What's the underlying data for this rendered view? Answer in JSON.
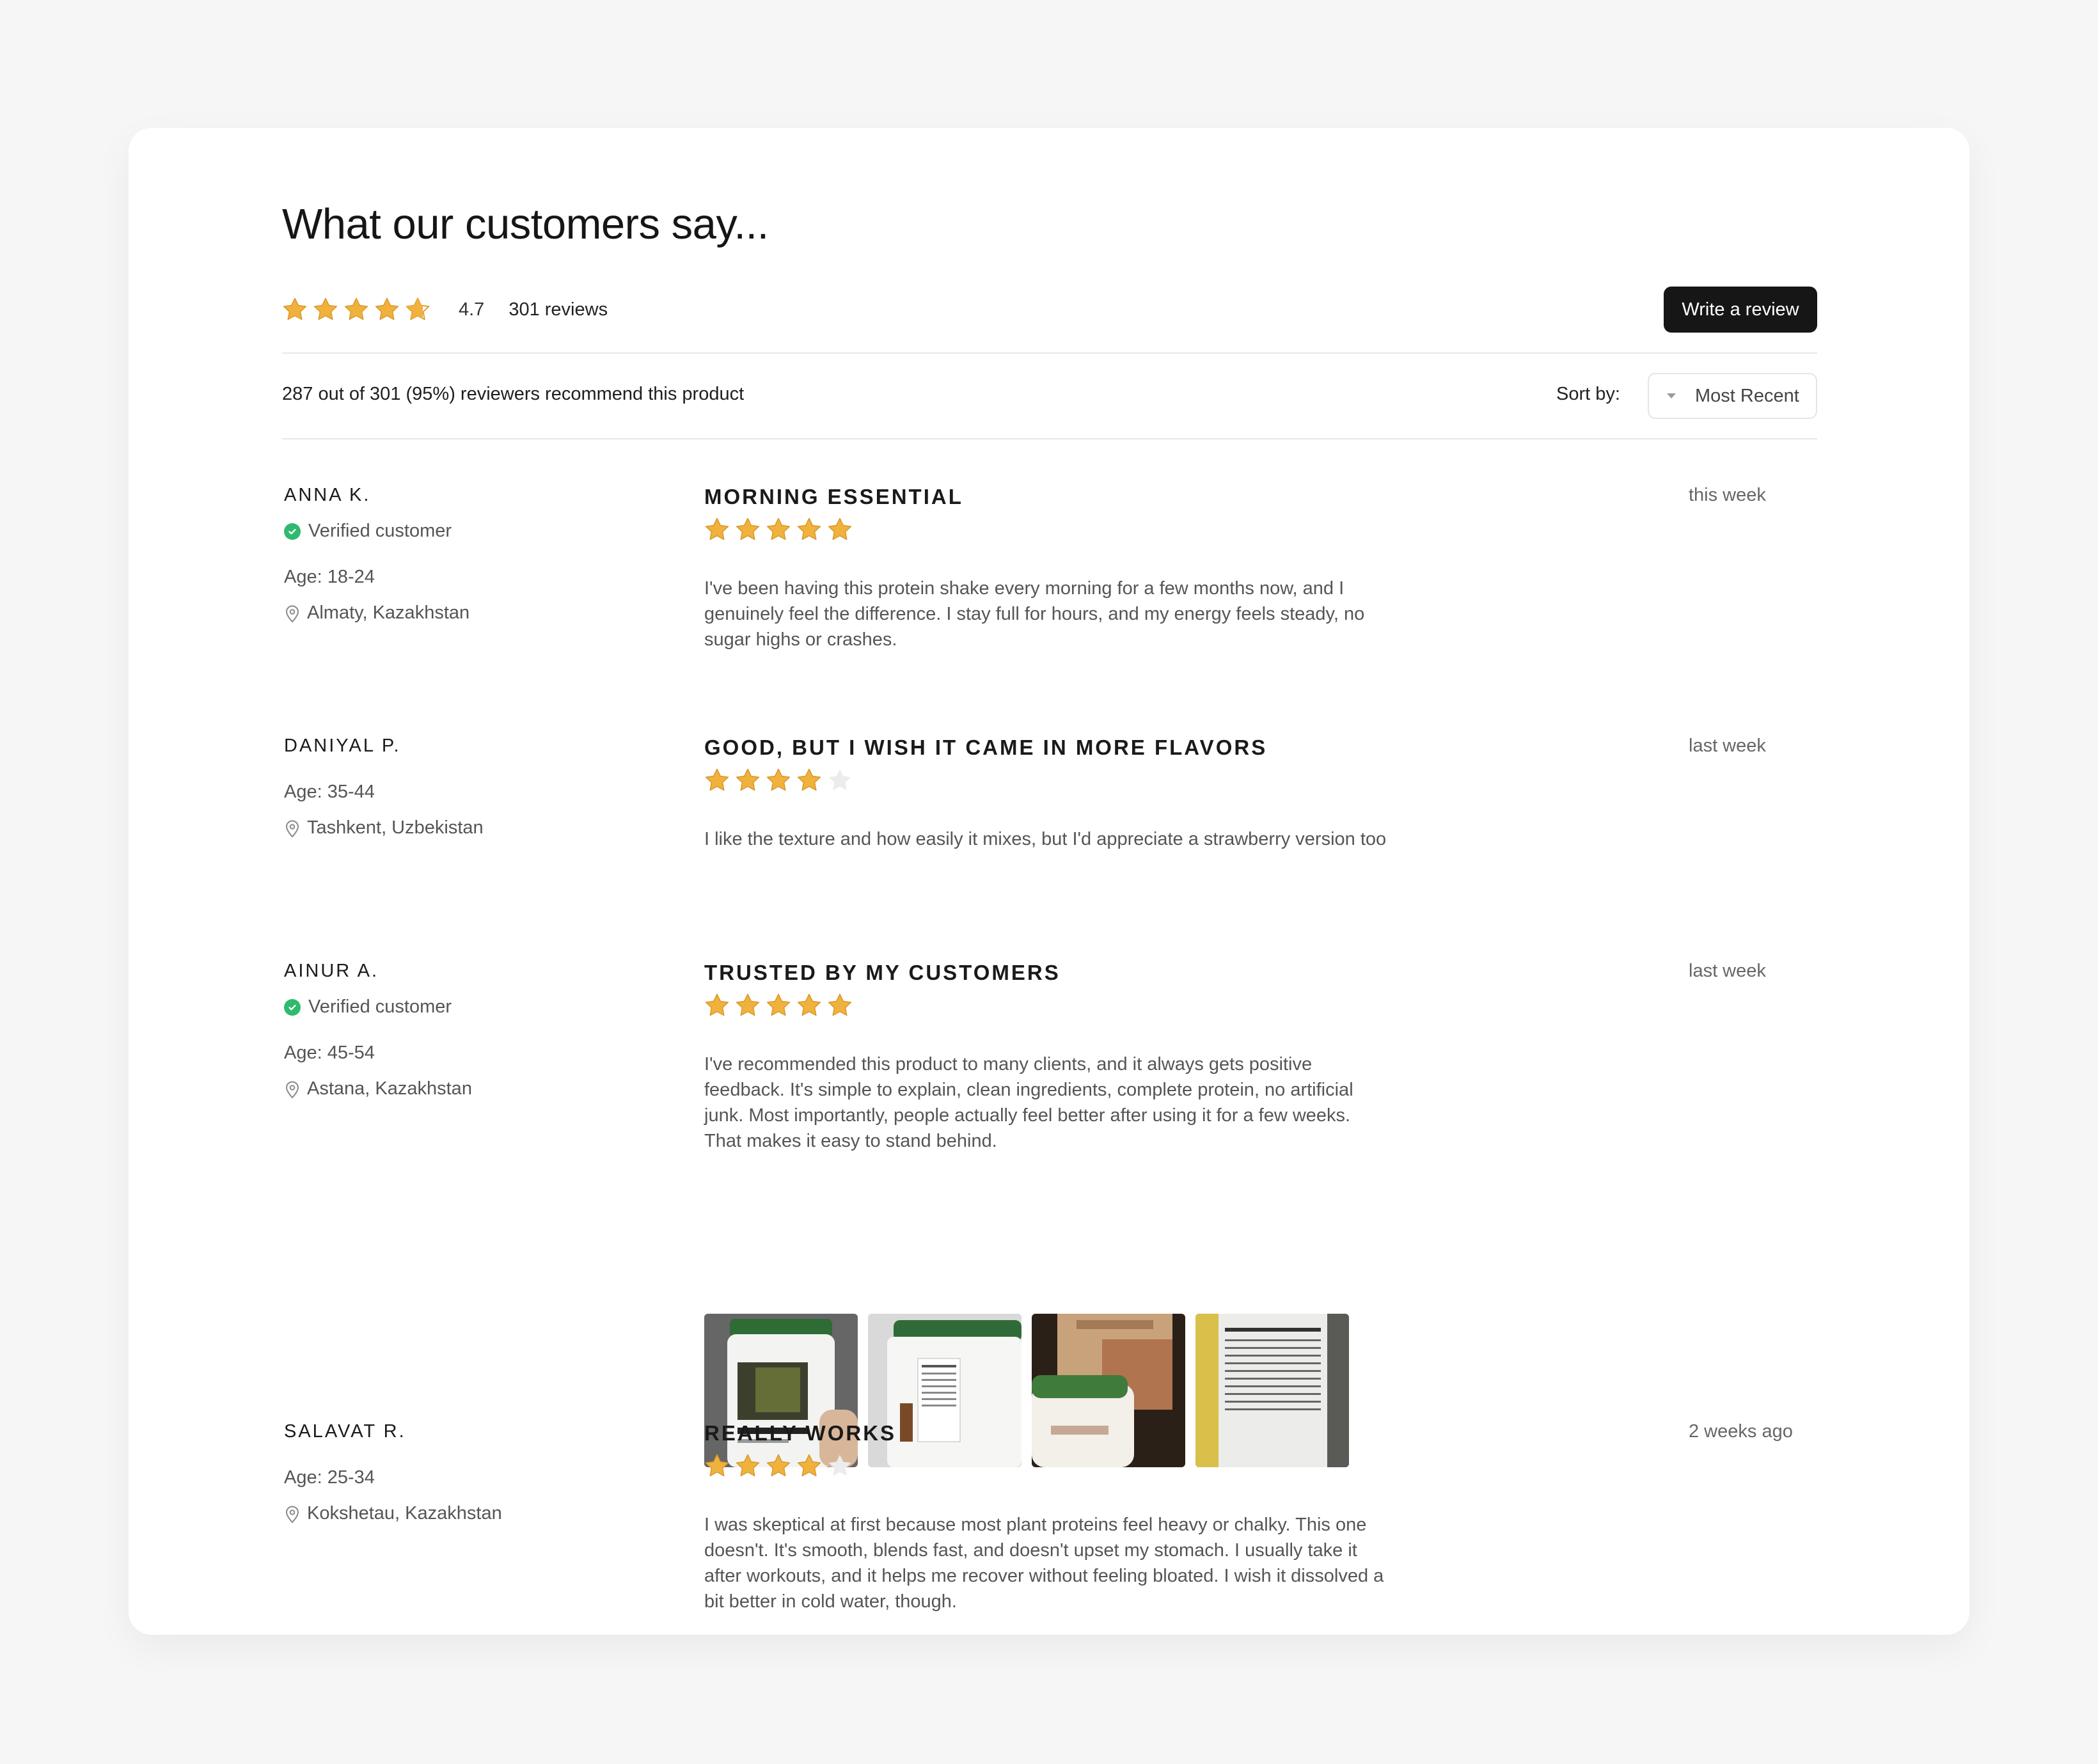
{
  "header": {
    "title": "What our customers say...",
    "rating": "4.7",
    "rating_value": 4.7,
    "reviews_count": "301 reviews",
    "write_review_label": "Write a review"
  },
  "filter_bar": {
    "recommend_text": "287 out of 301 (95%) reviewers recommend this product",
    "sort_label": "Sort by:",
    "sort_value": "Most Recent"
  },
  "reviews": [
    {
      "name": "ANNA K.",
      "verified": "Verified customer",
      "age": "Age: 18-24",
      "location": "Almaty, Kazakhstan",
      "title": "MORNING ESSENTIAL",
      "rating": 5,
      "body": "I've been having this protein shake every morning for a few months now, and I genuinely feel the difference. I stay full for hours, and my energy feels steady, no sugar highs or crashes.",
      "date": "this week"
    },
    {
      "name": "DANIYAL P.",
      "age": "Age: 35-44",
      "location": "Tashkent, Uzbekistan",
      "title": "GOOD, BUT I WISH IT CAME IN MORE FLAVORS",
      "rating": 4,
      "body": "I like the texture and how easily it mixes, but I'd appreciate a strawberry version too",
      "date": "last week"
    },
    {
      "name": "AINUR A.",
      "verified": "Verified customer",
      "age": "Age: 45-54",
      "location": "Astana, Kazakhstan",
      "title": "TRUSTED BY MY CUSTOMERS",
      "rating": 5,
      "body": "I've recommended this product to many clients, and it always gets positive feedback. It's simple to explain, clean ingredients, complete protein, no artificial junk. Most importantly, people actually feel better after using it for a few weeks. That makes it easy to stand behind.",
      "date": "last week",
      "photos": [
        "protein-tub-photo",
        "tub-label-photo",
        "plant-protein-bags-photo",
        "supplement-facts-photo"
      ]
    },
    {
      "name": "SALAVAT R.",
      "age": "Age: 25-34",
      "location": "Kokshetau, Kazakhstan",
      "title": "REALLY WORKS",
      "rating": 4,
      "body": "I was skeptical at first because most plant proteins feel heavy or chalky. This one doesn't. It's smooth, blends fast, and doesn't upset my stomach. I usually take it after workouts, and it helps me recover without feeling bloated. I wish it dissolved a bit better in cold water, though.",
      "date": "2 weeks ago"
    }
  ],
  "colors": {
    "star": "#f0b23c",
    "star_empty": "#ececec",
    "verified": "#2fba6e",
    "button": "#161616"
  }
}
